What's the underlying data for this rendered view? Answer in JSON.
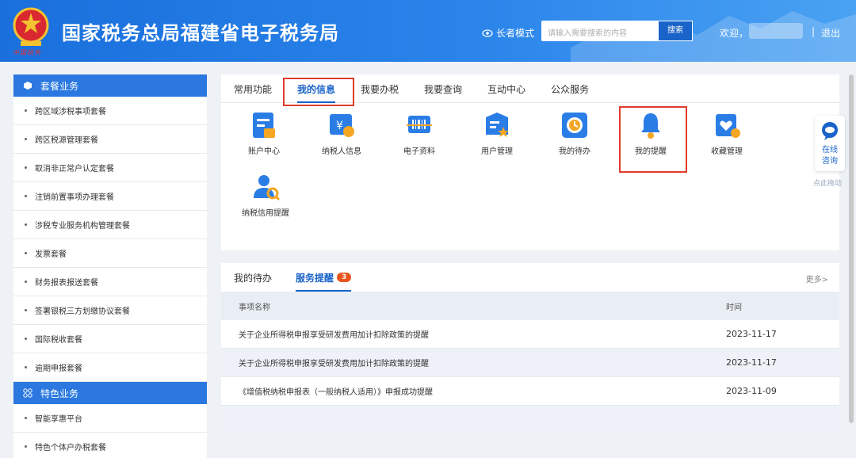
{
  "header": {
    "title": "国家税务总局福建省电子税务局",
    "slogan": "中国税务",
    "elder_mode": "长者模式",
    "search_placeholder": "请输入需要搜索的内容",
    "search_button": "搜索",
    "welcome": "欢迎，",
    "separator": "|",
    "logout": "退出"
  },
  "sidebar": {
    "section1": "套餐业务",
    "items1": [
      "跨区域涉税事项套餐",
      "跨区税源管理套餐",
      "取消非正常户认定套餐",
      "注销前置事项办理套餐",
      "涉税专业服务机构管理套餐",
      "发票套餐",
      "财务报表报送套餐",
      "签署银税三方划缴协议套餐",
      "国际税收套餐",
      "逾期申报套餐"
    ],
    "section2": "特色业务",
    "items2": [
      "智能享惠平台",
      "特色个体户办税套餐"
    ]
  },
  "tabs": [
    "常用功能",
    "我的信息",
    "我要办税",
    "我要查询",
    "互动中心",
    "公众服务"
  ],
  "icons": [
    "账户中心",
    "纳税人信息",
    "电子资料",
    "用户管理",
    "我的待办",
    "我的提醒",
    "收藏管理",
    "纳税信用提醒"
  ],
  "bottom": {
    "tabs": [
      "我的待办",
      "服务提醒"
    ],
    "badge": "3",
    "more": "更多>",
    "col_name": "事项名称",
    "col_time": "时间",
    "rows": [
      {
        "name": "关于企业所得税申报享受研发费用加计扣除政策的提醒",
        "time": "2023-11-17"
      },
      {
        "name": "关于企业所得税申报享受研发费用加计扣除政策的提醒",
        "time": "2023-11-17"
      },
      {
        "name": "《增值税纳税申报表（一般纳税人适用）》申报成功提醒",
        "time": "2023-11-09"
      }
    ]
  },
  "float": {
    "line1": "在线",
    "line2": "咨询",
    "drag": "点此拖动"
  },
  "colors": {
    "primary": "#1a63c8",
    "header": "#2a84ea",
    "highlight": "#e03c2c",
    "badge": "#e8541c"
  }
}
